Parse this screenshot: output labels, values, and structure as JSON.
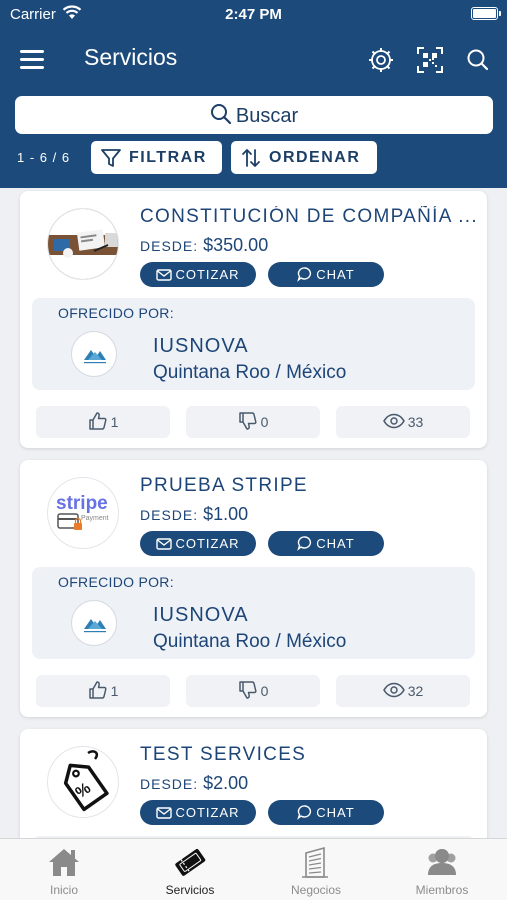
{
  "status_bar": {
    "carrier": "Carrier",
    "time": "2:47 PM"
  },
  "header": {
    "title": "Servicios",
    "icons": [
      "menu-icon",
      "settings-gear-icon",
      "qr-code-icon",
      "search-icon"
    ]
  },
  "search": {
    "placeholder": "Buscar"
  },
  "toolbar": {
    "count": "1 - 6 / 6",
    "filter_label": "FILTRAR",
    "sort_label": "ORDENAR"
  },
  "services": [
    {
      "title": "CONSTITUCIÓN DE COMPAÑÍA ...",
      "price_label": "DESDE:",
      "price": "$350.00",
      "quote_label": "COTIZAR",
      "chat_label": "CHAT",
      "offered_by_label": "OFRECIDO POR:",
      "org_name": "IUSNOVA",
      "org_location": "Quintana Roo / México",
      "likes": "1",
      "dislikes": "0",
      "views": "33"
    },
    {
      "title": "PRUEBA STRIPE",
      "price_label": "DESDE:",
      "price": "$1.00",
      "quote_label": "COTIZAR",
      "chat_label": "CHAT",
      "offered_by_label": "OFRECIDO POR:",
      "org_name": "IUSNOVA",
      "org_location": "Quintana Roo / México",
      "likes": "1",
      "dislikes": "0",
      "views": "32",
      "thumb_text": "stripe",
      "thumb_subtext": "Payment"
    },
    {
      "title": "TEST SERVICES",
      "price_label": "DESDE:",
      "price": "$2.00",
      "quote_label": "COTIZAR",
      "chat_label": "CHAT"
    }
  ],
  "tabbar": {
    "items": [
      {
        "label": "Inicio",
        "icon": "home-icon"
      },
      {
        "label": "Servicios",
        "icon": "ticket-icon"
      },
      {
        "label": "Negocios",
        "icon": "building-icon"
      },
      {
        "label": "Miembros",
        "icon": "members-icon"
      }
    ],
    "active": "Servicios"
  },
  "colors": {
    "primary": "#1c4a7a",
    "text": "#1d4577",
    "background": "#eef0f3"
  }
}
